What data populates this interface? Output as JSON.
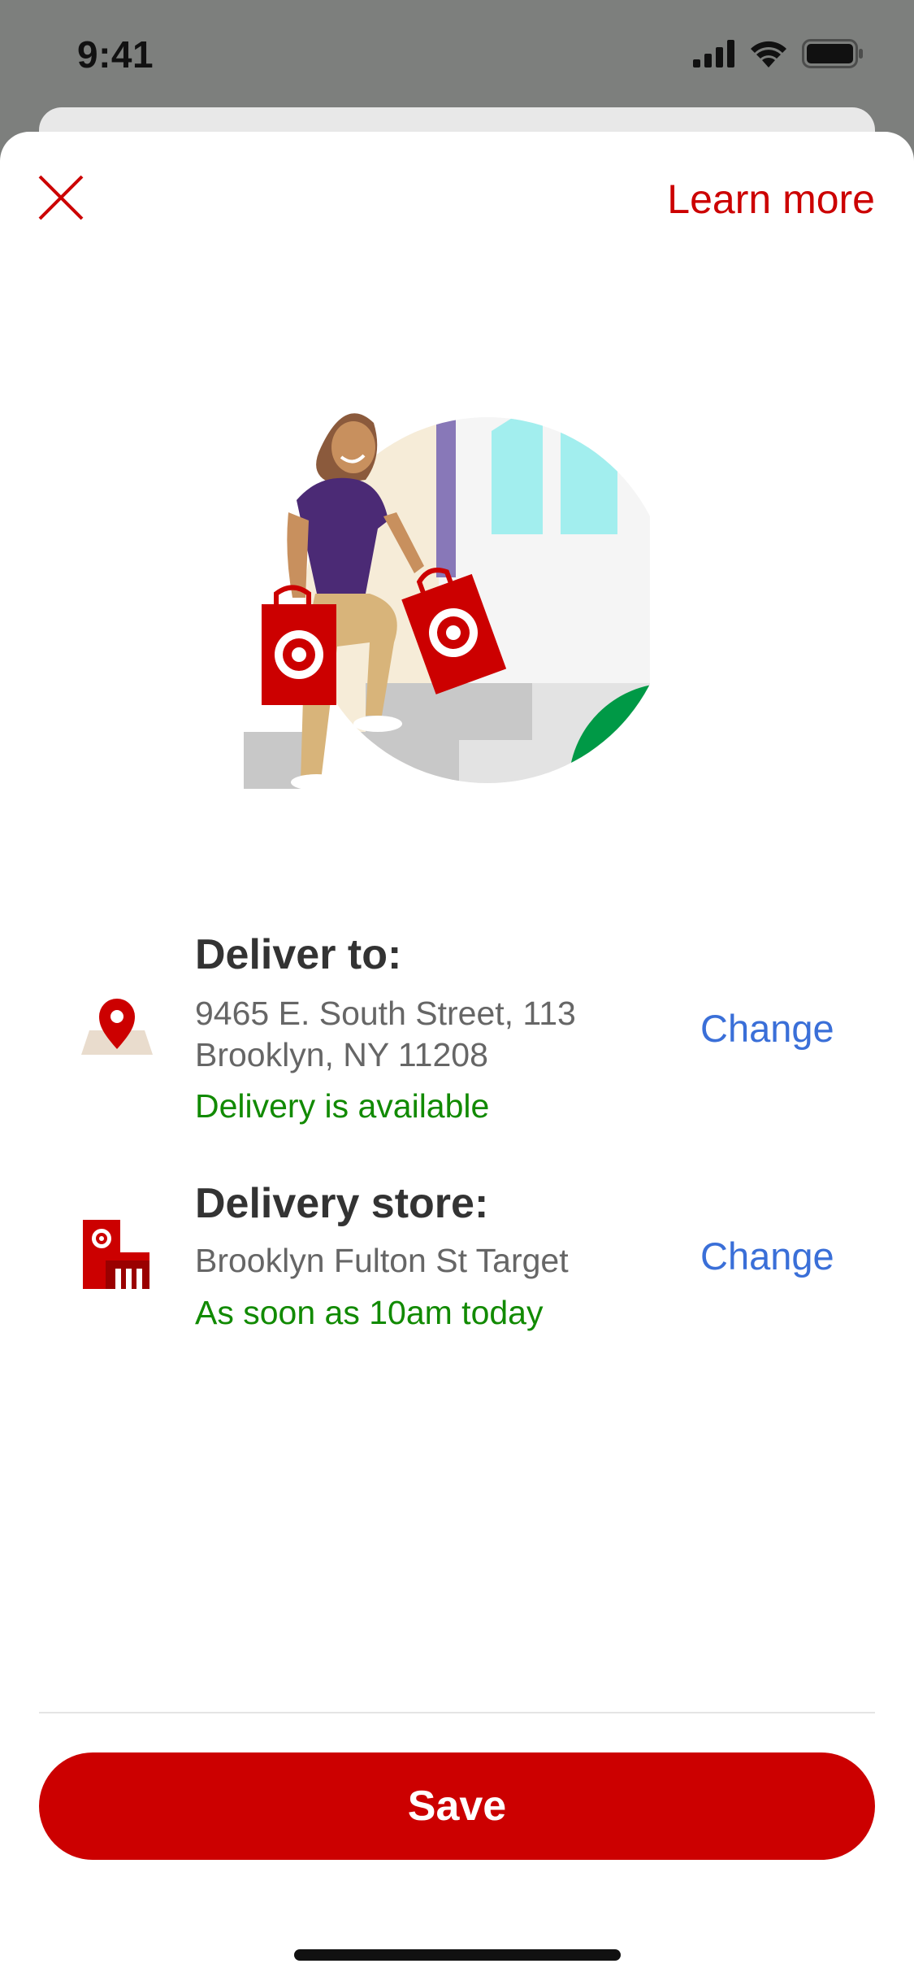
{
  "status_bar": {
    "time": "9:41"
  },
  "header": {
    "learn_more_label": "Learn more"
  },
  "deliver_to": {
    "title": "Deliver to:",
    "address_line1": "9465 E. South Street, 113",
    "address_line2": "Brooklyn, NY 11208",
    "status": "Delivery is available",
    "change_label": "Change"
  },
  "delivery_store": {
    "title": "Delivery store:",
    "store_name": "Brooklyn Fulton St Target",
    "status": "As soon as 10am today",
    "change_label": "Change"
  },
  "footer": {
    "save_label": "Save"
  },
  "icons": {
    "close": "close-icon",
    "location": "location-pin-icon",
    "store": "store-icon",
    "signal": "cellular-signal-icon",
    "wifi": "wifi-icon",
    "battery": "battery-icon"
  },
  "colors": {
    "brand_red": "#cc0000",
    "link_blue": "#3a6fd8",
    "success_green": "#118a00",
    "title_text": "#333333",
    "body_text": "#666666"
  }
}
